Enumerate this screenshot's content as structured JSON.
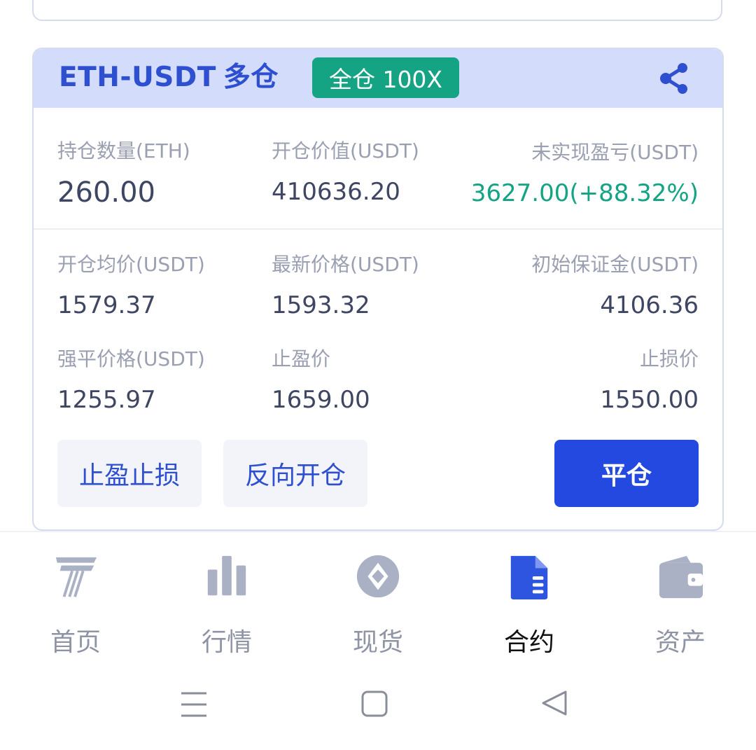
{
  "position": {
    "pair": "ETH-USDT",
    "side": "多仓",
    "mode_badge": "全仓 100X",
    "row1": {
      "hold_label": "持仓数量(ETH)",
      "hold_value": "260.00",
      "open_value_label": "开仓价值(USDT)",
      "open_value": "410636.20",
      "pnl_label": "未实现盈亏(USDT)",
      "pnl_value": "3627.00(+88.32%)"
    },
    "row2": {
      "avg_price_label": "开仓均价(USDT)",
      "avg_price": "1579.37",
      "last_price_label": "最新价格(USDT)",
      "last_price": "1593.32",
      "init_margin_label": "初始保证金(USDT)",
      "init_margin": "4106.36"
    },
    "row3": {
      "liq_price_label": "强平价格(USDT)",
      "liq_price": "1255.97",
      "tp_label": "止盈价",
      "tp_value": "1659.00",
      "sl_label": "止损价",
      "sl_value": "1550.00"
    },
    "buttons": {
      "tp_sl": "止盈止损",
      "reverse": "反向开仓",
      "close": "平仓"
    }
  },
  "bottom_nav": {
    "items": [
      {
        "label": "首页",
        "icon": "home-logo-icon"
      },
      {
        "label": "行情",
        "icon": "bar-chart-icon"
      },
      {
        "label": "现货",
        "icon": "spot-exchange-icon"
      },
      {
        "label": "合约",
        "icon": "contract-document-icon",
        "active": true
      },
      {
        "label": "资产",
        "icon": "wallet-icon"
      }
    ]
  },
  "colors": {
    "accent": "#2449e1",
    "profit": "#14a383",
    "header_bg": "#d3dcfb"
  }
}
